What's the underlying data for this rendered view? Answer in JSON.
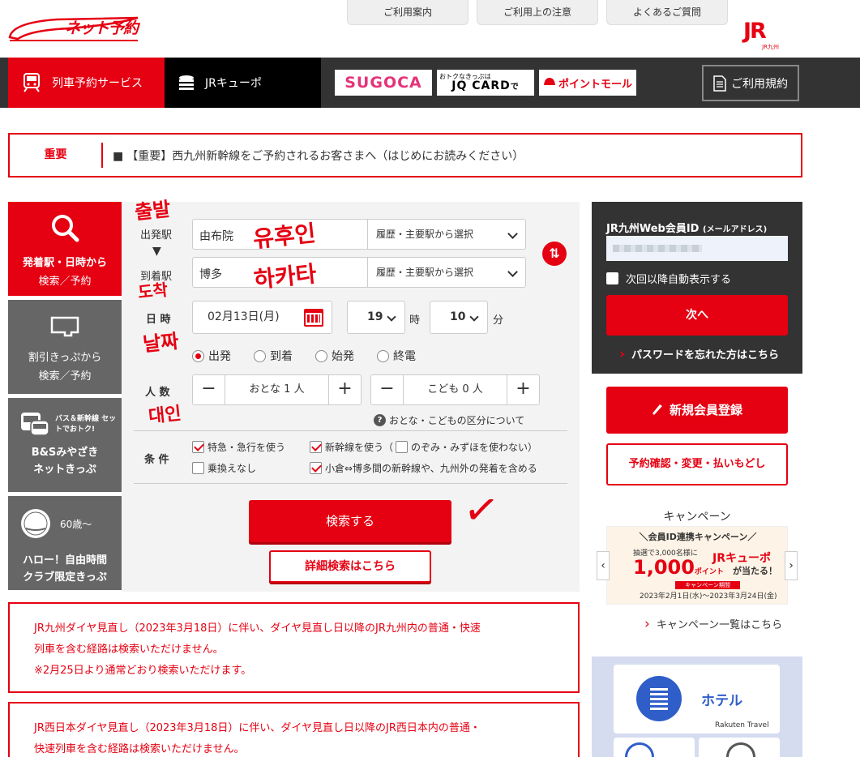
{
  "header": {
    "logo_text": "ネット予約",
    "links": [
      "ご利用案内",
      "ご利用上の注意",
      "よくあるご質問"
    ],
    "brand": "JR",
    "brand_sub": "JR九州"
  },
  "nav": {
    "train": "列車予約サービス",
    "kyupo": "JRキューポ",
    "banners": {
      "sugoca": "SUGOCA",
      "jq_small": "おトクなきっぷは",
      "jq_main": "JQ CARD",
      "jq_suffix": "で",
      "point": "ポイントモール"
    },
    "rules": "ご利用規約"
  },
  "important": {
    "label": "重要",
    "text": "【重要】西九州新幹線をご予約されるお客さまへ（はじめにお読みください）"
  },
  "left_tabs": [
    {
      "line1": "発着駅・日時から",
      "line2": "検索／予約"
    },
    {
      "line1": "割引きっぷから",
      "line2": "検索／予約"
    },
    {
      "line1": "B&Sみやざき",
      "line2": "ネットきっぷ",
      "tag": "バス＆新幹線 セットでおトク!"
    },
    {
      "line1": "ハロー！自由時間",
      "line2": "クラブ限定きっぷ",
      "tag": "60歳～"
    }
  ],
  "search": {
    "from_label": "出発駅",
    "to_label": "到着駅",
    "arrow": "▼",
    "from_value": "由布院",
    "to_value": "博多",
    "select_label": "履歴・主要駅から選択",
    "swap": "⇅",
    "datetime_label": "日 時",
    "date_value": "02月13日(月)",
    "hour": "19",
    "hour_unit": "時",
    "minute": "10",
    "minute_unit": "分",
    "radio": [
      "出発",
      "到着",
      "始発",
      "終電"
    ],
    "people_label": "人 数",
    "adult": "おとな 1 人",
    "child": "こども 0 人",
    "minus": "−",
    "plus": "+",
    "help": "おとな・こどもの区分について",
    "cond_label": "条 件",
    "conditions": [
      "特急・急行を使う",
      "新幹線を使う（",
      "のぞみ・みずほを使わない）",
      "乗換えなし",
      "小倉⇔博多間の新幹線や、九州外の発着を含める"
    ],
    "search_btn": "検索する",
    "detail_btn": "詳細検索はこちら"
  },
  "notices": [
    [
      "JR九州ダイヤ見直し（2023年3月18日）に伴い、ダイヤ見直し日以降のJR九州内の普通・快速",
      "列車を含む経路は検索いただけません。",
      "※2月25日より通常どおり検索いただけます。"
    ],
    [
      "JR西日本ダイヤ見直し（2023年3月18日）に伴い、ダイヤ見直し日以降のJR西日本内の普通・",
      "快速列車を含む経路は検索いただけません。"
    ]
  ],
  "login": {
    "title": "JR九州Web会員ID",
    "title_sub": "(メールアドレス)",
    "auto_display": "次回以降自動表示する",
    "next": "次へ",
    "forgot": "パスワードを忘れた方はこちら"
  },
  "right": {
    "register": "新規会員登録",
    "confirm": "予約確認・変更・払いもどし",
    "campaign_title": "キャンペーン",
    "campaign_banner": {
      "title": "＼会員ID連携キャンペーン／",
      "lottery": "抽選で3,000名様に",
      "amount": "1,000",
      "amount_unit": "ポイント",
      "brand": "JRキューポ",
      "result": "が当たる！",
      "period_label": "キャンペーン期間",
      "period": "2023年2月1日(水)～2023年3月24日(金)"
    },
    "campaign_list": "キャンペーン一覧はこちら",
    "hotel": "ホテル",
    "rakuten": "Rakuten Travel"
  },
  "annotations": [
    "출발",
    "도착",
    "유후인",
    "하카타",
    "날짜",
    "대인",
    "✓"
  ],
  "colors": {
    "accent": "#e50012",
    "nav_dark": "#333333",
    "hotel_blue": "#2f5ec9"
  }
}
